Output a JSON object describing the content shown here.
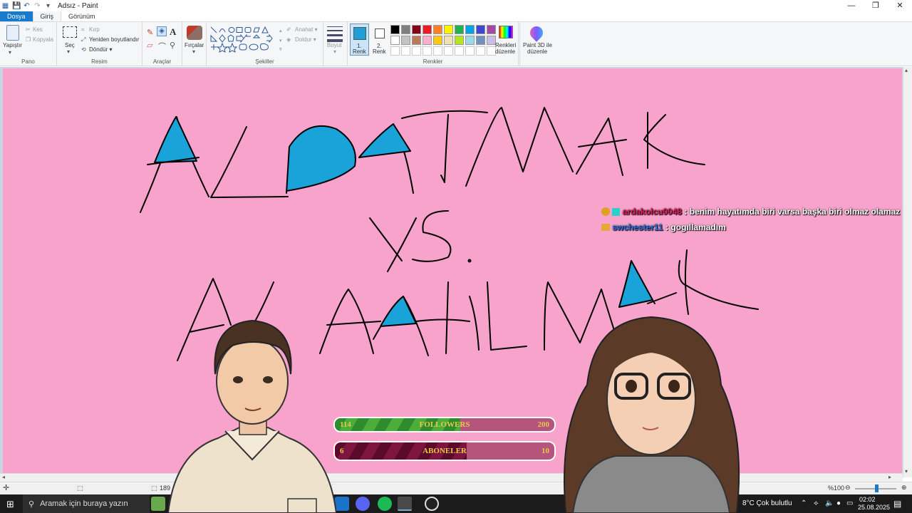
{
  "window": {
    "title": "Adsız - Paint",
    "controls": [
      "—",
      "❐",
      "✕"
    ]
  },
  "tabs": [
    {
      "label": "Dosya"
    },
    {
      "label": "Giriş"
    },
    {
      "label": "Görünüm"
    }
  ],
  "ribbon": {
    "clipboard": {
      "label": "Pano",
      "paste": "Yapıştır",
      "cut": "Kes",
      "copy": "Kopyala"
    },
    "image": {
      "label": "Resim",
      "select": "Seç",
      "crop": "Kırp",
      "resize": "Yeniden boyutlandır",
      "rotate": "Döndür ▾"
    },
    "tools": {
      "label": "Araçlar"
    },
    "brushes": {
      "label": "Fırçalar"
    },
    "shapes": {
      "label": "Şekiller",
      "outline": "Anahat ▾",
      "fill": "Doldur ▾"
    },
    "size": {
      "label": "Boyut"
    },
    "color1": {
      "line1": "1.",
      "line2": "Renk",
      "value": "#1e9fd6"
    },
    "color2": {
      "line1": "2.",
      "line2": "Renk",
      "value": "#ffffff"
    },
    "colors": {
      "label": "Renkler",
      "palette": [
        "#000000",
        "#7f7f7f",
        "#880015",
        "#ed1c24",
        "#ff7f27",
        "#fff200",
        "#22b14c",
        "#00a2e8",
        "#3f48cc",
        "#a349a4",
        "#ffffff",
        "#c3c3c3",
        "#b97a57",
        "#ffaec9",
        "#ffc90e",
        "#efe4b0",
        "#b5e61d",
        "#99d9ea",
        "#7092be",
        "#c8bfe7",
        "#ffffff",
        "#ffffff",
        "#ffffff",
        "#ffffff",
        "#ffffff",
        "#ffffff",
        "#ffffff",
        "#ffffff",
        "#ffffff",
        "#ffffff"
      ],
      "edit_line1": "Renkleri",
      "edit_line2": "düzenle"
    },
    "paint3d": {
      "line1": "Paint 3D ile",
      "line2": "düzenle"
    }
  },
  "canvas": {
    "background": "#f7a3cb",
    "fill_color": "#1aa3d9"
  },
  "chat": [
    {
      "user": "ardakolcu0048",
      "sep": " : ",
      "message": "benim hayatımda biri varsa başka biri olmaz olamaz"
    },
    {
      "user": "swchester11",
      "sep": " : ",
      "message": "gogıllamadım"
    }
  ],
  "goals": [
    {
      "current": "114",
      "label": "FOLLOWERS",
      "target": "200",
      "progress": 0.57
    },
    {
      "current": "6",
      "label": "ABONELER",
      "target": "10",
      "progress": 0.6
    }
  ],
  "statusbar": {
    "size_partial": "189",
    "zoom": "%100"
  },
  "taskbar": {
    "search_placeholder": "Aramak için buraya yazın",
    "weather": "8°C  Çok bulutlu",
    "time": "02:02",
    "date": "25.08.2025"
  }
}
